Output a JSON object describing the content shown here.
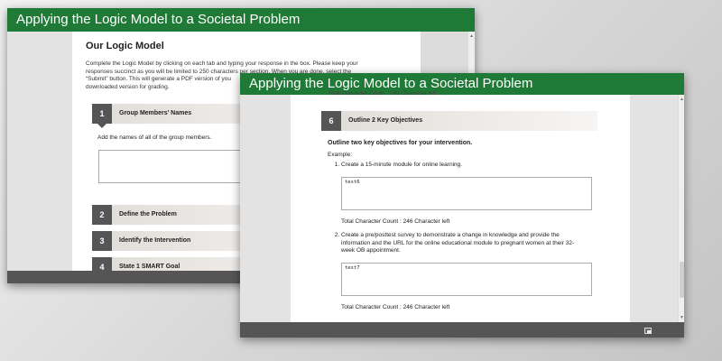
{
  "back_window": {
    "title": "Applying the Logic Model to a Societal Problem",
    "heading": "Our Logic Model",
    "intro_lines": [
      "Complete the Logic Model by clicking on each tab and typing your response in the box. Please keep your",
      "responses succinct as you will be limited to 250 characters per section. When you are done, select the",
      "“Submit” button. This will generate a PDF version of you",
      "downloaded version for grading."
    ],
    "steps": [
      {
        "num": "1",
        "label": "Group Members’ Names"
      },
      {
        "num": "2",
        "label": "Define the Problem"
      },
      {
        "num": "3",
        "label": "Identify the Intervention"
      },
      {
        "num": "4",
        "label": "State 1 SMART Goal"
      }
    ],
    "step1_instruction": "Add the names of all of the group members."
  },
  "front_window": {
    "title": "Applying the Logic Model to a Societal Problem",
    "top_count": "Total Character Count : 246 Character left",
    "step": {
      "num": "6",
      "label": "Outline 2 Key Objectives"
    },
    "prompt": "Outline two key objectives for your intervention.",
    "example_label": "Example:",
    "examples": [
      {
        "text": "Create a 15-minute module for online learning.",
        "value": "test6",
        "count": "Total Character Count : 246 Character left"
      },
      {
        "text_lines": [
          "Create a pre/posttest survey to demonstrate a change in knowledge and provide the",
          "information and the URL for the online educational module to pregnant women at their 32-",
          "week OB appointment."
        ],
        "value": "test7",
        "count": "Total Character Count : 246 Character left"
      }
    ]
  },
  "colors": {
    "titlebar": "#1f7a37",
    "step_badge": "#555555",
    "footer_bar": "#555555"
  }
}
